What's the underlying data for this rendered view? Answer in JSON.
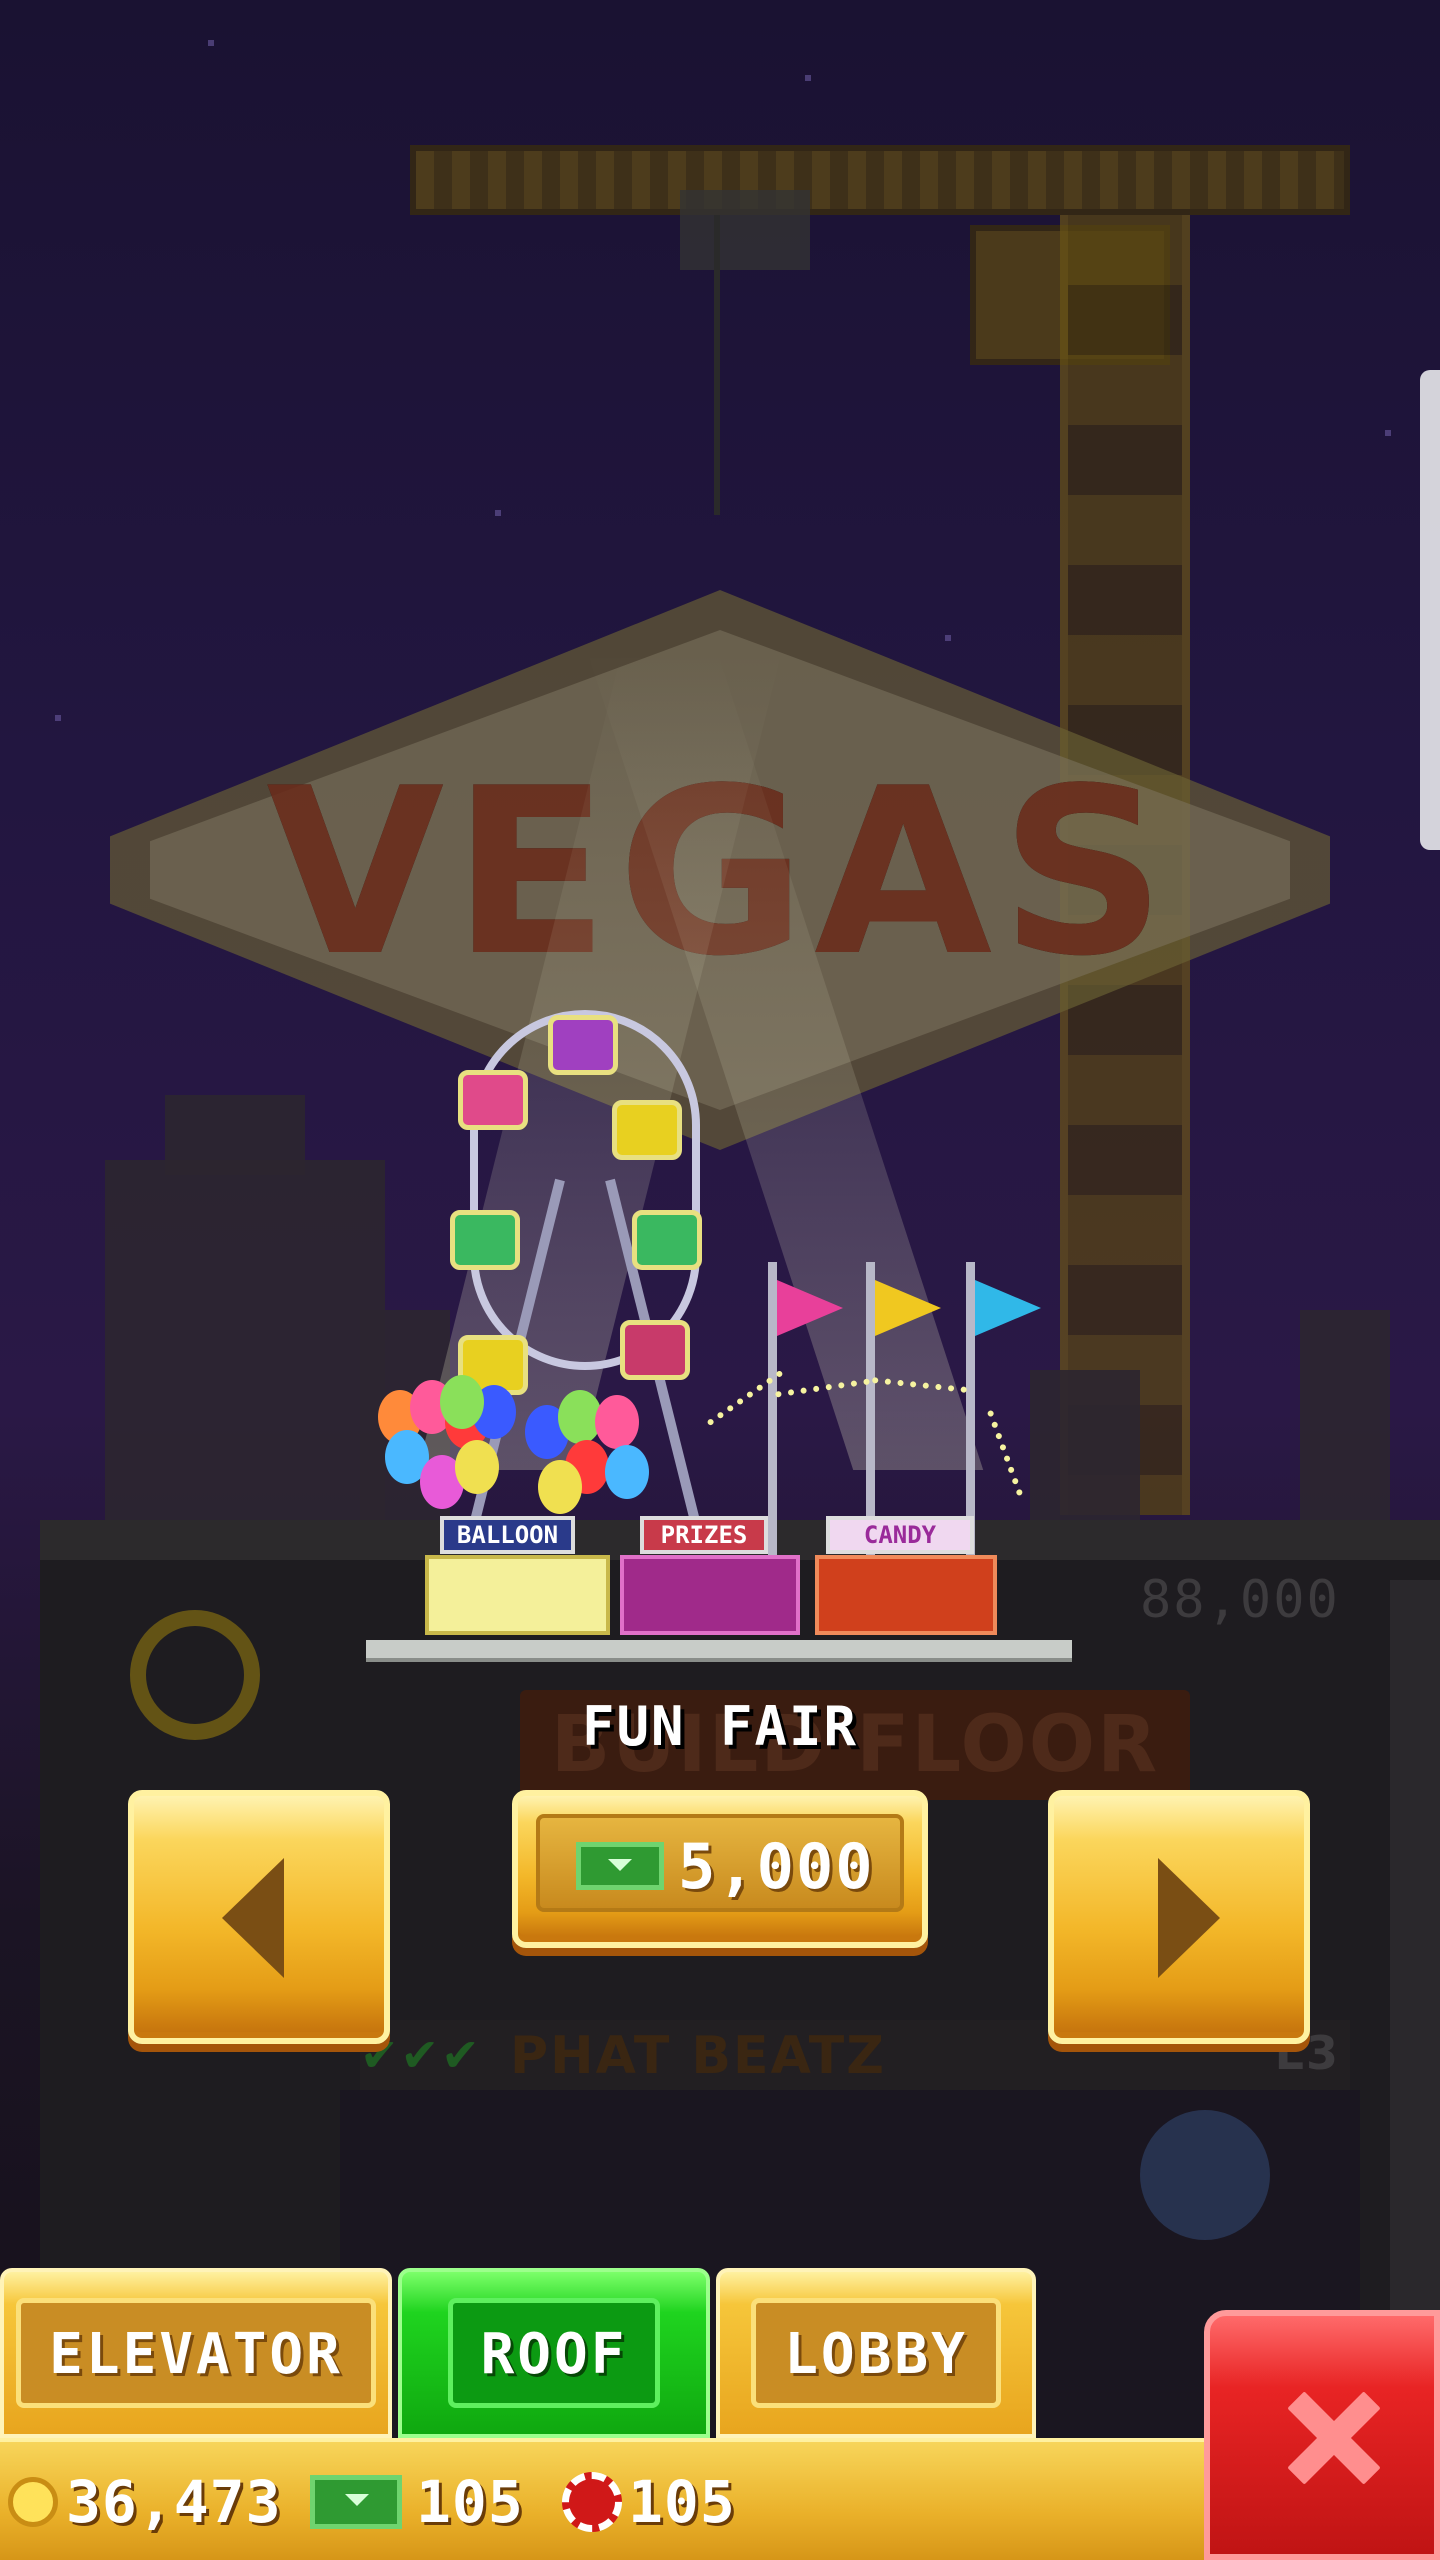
{
  "scene": {
    "sign_text": "VEGAS",
    "ghost_floor_price": "88,000",
    "ghost_build_floor": "BUILD FLOOR",
    "ghost_floor_name": "PHAT BEATZ",
    "ghost_floor_level": "L3"
  },
  "preview": {
    "title": "FUN FAIR",
    "booths": [
      "BALLOON",
      "PRIZES",
      "CANDY"
    ]
  },
  "purchase": {
    "price": "5,000",
    "currency_icon": "bux-icon"
  },
  "navigation": {
    "prev_icon": "arrow-left-icon",
    "next_icon": "arrow-right-icon"
  },
  "tabs": [
    {
      "label": "ELEVATOR",
      "active": false
    },
    {
      "label": "ROOF",
      "active": true
    },
    {
      "label": "LOBBY",
      "active": false
    }
  ],
  "resources": {
    "coins": "36,473",
    "bux": "105",
    "chips": "105"
  },
  "colors": {
    "gold": "#f3b729",
    "active_tab": "#1fd41f",
    "close": "#e82424",
    "cash_green": "#2f9a32"
  }
}
